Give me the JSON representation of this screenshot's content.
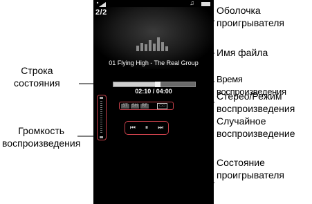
{
  "screen": {
    "track_counter": "2/2",
    "filename": "01 Flying High - The Real Group",
    "time": "02:10 / 04:00",
    "progress": 0.54,
    "badges": [
      "ST",
      "SH",
      "RF"
    ],
    "controls": {
      "prev": "⏮",
      "pause": "⏸",
      "next": "⏭"
    }
  },
  "callouts": {
    "player_shell": [
      "Оболочка",
      "проигрывателя"
    ],
    "filename": "Имя файла",
    "playback_time": "Время воспроизведения",
    "stereo_mode": [
      "Стерео/Режим",
      "воспроизведения",
      "Случайное",
      "воспроизведение"
    ],
    "player_state": [
      "Состояние",
      "проигрывателя"
    ],
    "status_bar": [
      "Строка",
      "состояния"
    ],
    "volume": [
      "Громкость",
      "воспроизведения"
    ]
  },
  "colors": {
    "highlight_border": "#c8404a",
    "screen_background": "#000000"
  }
}
